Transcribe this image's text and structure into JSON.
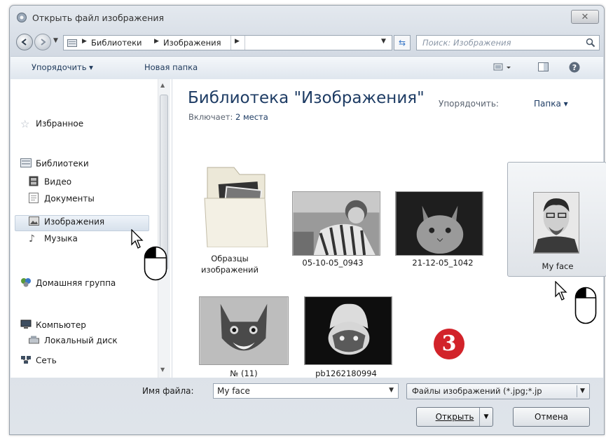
{
  "window": {
    "title": "Открыть файл изображения",
    "close_symbol": "✕"
  },
  "nav": {
    "crumbs": [
      "Библиотеки",
      "Изображения"
    ],
    "search_placeholder": "Поиск: Изображения"
  },
  "toolbar": {
    "organize": "Упорядочить ▾",
    "new_folder": "Новая папка"
  },
  "sidebar": {
    "favorites": "Избранное",
    "libraries": "Библиотеки",
    "video": "Видео",
    "documents": "Документы",
    "images": "Изображения",
    "music": "Музыка",
    "homegroup": "Домашняя группа",
    "computer": "Компьютер",
    "local_disk": "Локальный диск",
    "network": "Сеть"
  },
  "library": {
    "title": "Библиотека \"Изображения\"",
    "includes_label": "Включает:",
    "includes_value": "2 места",
    "arrange_label": "Упорядочить:",
    "arrange_value": "Папка ▾"
  },
  "files": [
    {
      "caption": "Образцы изображений",
      "type": "folder"
    },
    {
      "caption": "05-10-05_0943",
      "type": "photo"
    },
    {
      "caption": "21-12-05_1042",
      "type": "photo"
    },
    {
      "caption": "My face",
      "type": "photo",
      "selected": true
    },
    {
      "caption": "№ (11)",
      "type": "photo"
    },
    {
      "caption": "pb1262180994",
      "type": "photo"
    }
  ],
  "badge": "3",
  "bottom": {
    "filename_label": "Имя файла:",
    "filename_value": "My face",
    "filter_value": "Файлы изображений (*.jpg;*.jp",
    "open_button": "Открыть",
    "cancel_button": "Отмена"
  },
  "colors": {
    "accent_title": "#1e3c64",
    "badge": "#d2232a",
    "toolbar_text": "#1e395b"
  }
}
